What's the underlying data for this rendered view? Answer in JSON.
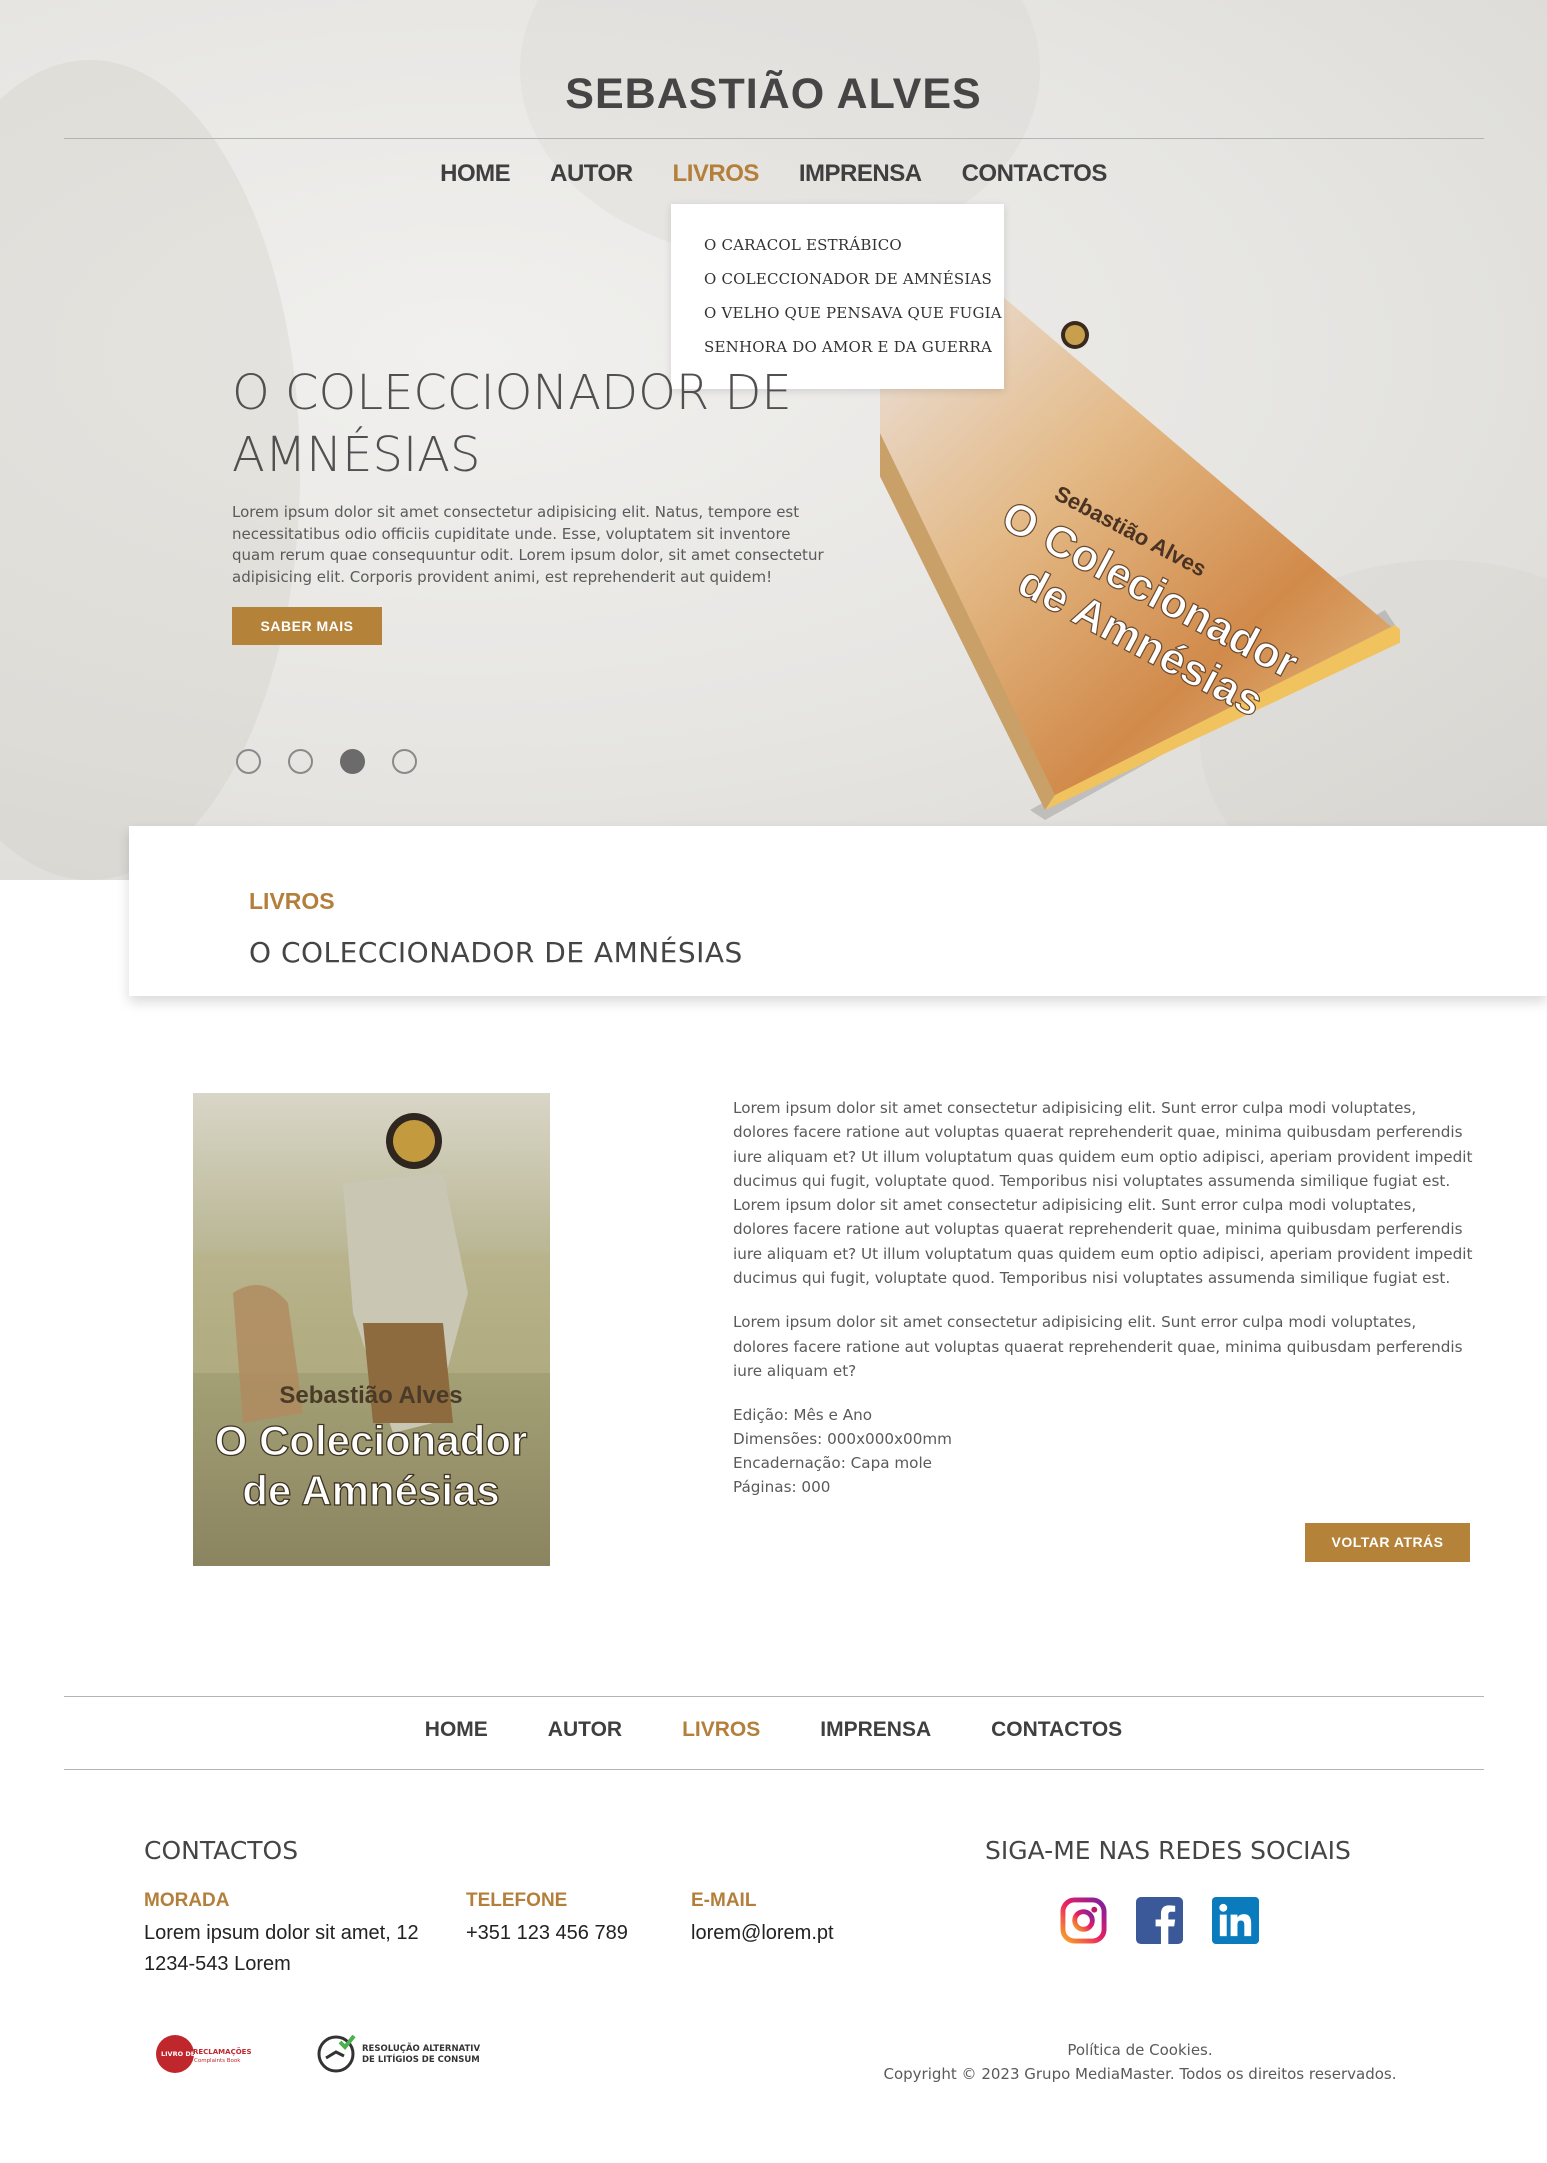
{
  "site": {
    "title": "SEBASTIÃO ALVES"
  },
  "nav": {
    "items": [
      {
        "label": "HOME",
        "active": false
      },
      {
        "label": "AUTOR",
        "active": false
      },
      {
        "label": "LIVROS",
        "active": true
      },
      {
        "label": "IMPRENSA",
        "active": false
      },
      {
        "label": "CONTACTOS",
        "active": false
      }
    ]
  },
  "dropdown": {
    "items": [
      "O CARACOL ESTRÁBICO",
      "O COLECCIONADOR DE AMNÉSIAS",
      "O VELHO QUE PENSAVA QUE FUGIA",
      "SENHORA DO AMOR E DA GUERRA"
    ]
  },
  "hero": {
    "heading_line1": "O COLECCIONADOR DE",
    "heading_line2": "AMNÉSIAS",
    "text": "Lorem ipsum dolor sit amet consectetur adipisicing elit. Natus, tempore est necessitatibus odio officiis cupiditate unde. Esse, voluptatem sit inventore quam rerum quae consequuntur odit. Lorem ipsum dolor, sit amet consectetur adipisicing elit. Corporis provident animi, est reprehenderit aut quidem!",
    "button": "SABER MAIS",
    "slides": 4,
    "active_slide": 3
  },
  "book_cover": {
    "author": "Sebastião Alves",
    "title_line1": "O Colecionador",
    "title_line2": "de Amnésias"
  },
  "section": {
    "kicker": "LIVROS",
    "title": "O COLECCIONADOR DE AMNÉSIAS"
  },
  "content": {
    "p1": "Lorem ipsum dolor sit amet consectetur adipisicing elit. Sunt error culpa modi voluptates, dolores facere ratione aut voluptas quaerat reprehenderit quae, minima quibusdam perferendis iure aliquam et? Ut illum voluptatum quas quidem eum optio adipisci, aperiam provident impedit ducimus qui fugit, voluptate quod. Temporibus nisi voluptates assumenda similique fugiat est. Lorem ipsum dolor sit amet consectetur adipisicing elit. Sunt error culpa modi voluptates, dolores facere ratione aut voluptas quaerat reprehenderit quae, minima quibusdam perferendis iure aliquam et? Ut illum voluptatum quas quidem eum optio adipisci, aperiam provident impedit ducimus qui fugit, voluptate quod. Temporibus nisi voluptates assumenda similique fugiat est.",
    "p2": "Lorem ipsum dolor sit amet consectetur adipisicing elit. Sunt error culpa modi voluptates, dolores facere ratione aut voluptas quaerat reprehenderit quae, minima quibusdam perferendis iure aliquam et?",
    "specs": [
      "Edição: Mês e Ano",
      "Dimensões: 000x000x00mm",
      "Encadernação: Capa mole",
      "Páginas: 000"
    ],
    "back_button": "VOLTAR ATRÁS"
  },
  "footer": {
    "contacts_title": "CONTACTOS",
    "address_label": "MORADA",
    "address_value_line1": "Lorem ipsum dolor sit amet, 12",
    "address_value_line2": "1234-543 Lorem",
    "phone_label": "TELEFONE",
    "phone_value": "+351 123 456 789",
    "email_label": "E-MAIL",
    "email_value": "lorem@lorem.pt",
    "social_title": "SIGA-ME NAS REDES SOCIAIS",
    "social_icons": [
      "instagram-icon",
      "facebook-icon",
      "linkedin-icon"
    ],
    "logo_rec_line1": "LIVRO DE",
    "logo_rec_line2": "RECLAMAÇÕES",
    "logo_rec_line3": "Complaints Book",
    "logo_ral_line1": "RESOLUÇÃO ALTERNATIVA",
    "logo_ral_line2": "DE LITÍGIOS DE CONSUMO",
    "cookies": "Política de Cookies.",
    "copyright": "Copyright © 2023 Grupo MediaMaster. Todos os direitos reservados."
  },
  "colors": {
    "accent": "#b48339",
    "text": "#454545"
  }
}
